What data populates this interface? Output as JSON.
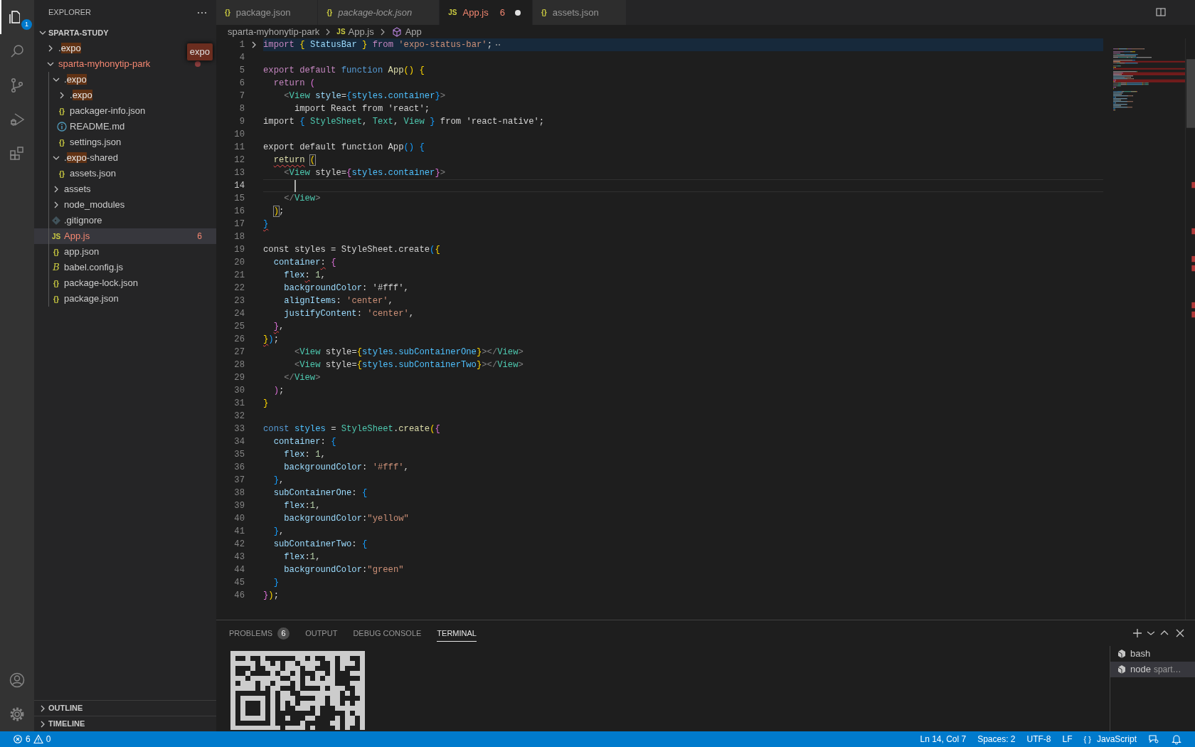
{
  "activity_bar": {
    "items": [
      {
        "kind": "explorer",
        "selected": true,
        "badge": "1"
      },
      {
        "kind": "search",
        "selected": false
      },
      {
        "kind": "source-control",
        "selected": false
      },
      {
        "kind": "run-debug",
        "selected": false
      },
      {
        "kind": "extensions",
        "selected": false
      }
    ],
    "bottom_items": [
      {
        "kind": "account"
      },
      {
        "kind": "settings"
      }
    ]
  },
  "sidebar": {
    "title": "EXPLORER",
    "filter": {
      "value": "expo"
    },
    "workspace": {
      "label": "SPARTA-STUDY",
      "expanded": true,
      "tree": [
        {
          "label_parts": [
            {
              "text": ".",
              "match": false
            },
            {
              "text": "expo",
              "match": true
            }
          ],
          "kind": "folder",
          "expanded": false,
          "selected": false,
          "problem": false
        },
        {
          "label_parts": [
            {
              "text": "sparta-myhonytip-park",
              "match": false
            }
          ],
          "kind": "folder",
          "expanded": true,
          "selected": false,
          "problem": true,
          "children": [
            {
              "label_parts": [
                {
                  "text": ".",
                  "match": false
                },
                {
                  "text": "expo",
                  "match": true
                }
              ],
              "kind": "folder",
              "expanded": true,
              "selected": false,
              "problem": false,
              "children": [
                {
                  "label_parts": [
                    {
                      "text": ".",
                      "match": false
                    },
                    {
                      "text": "expo",
                      "match": true
                    }
                  ],
                  "kind": "folder",
                  "expanded": false,
                  "selected": false,
                  "problem": false
                },
                {
                  "label_parts": [
                    {
                      "text": "packager-info.json",
                      "match": false
                    }
                  ],
                  "kind": "file",
                  "glyph": "{}",
                  "selected": false,
                  "problem": false
                },
                {
                  "label_parts": [
                    {
                      "text": "README.md",
                      "match": false
                    }
                  ],
                  "kind": "readme",
                  "selected": false,
                  "problem": false
                },
                {
                  "label_parts": [
                    {
                      "text": "settings.json",
                      "match": false
                    }
                  ],
                  "kind": "file",
                  "glyph": "{}",
                  "selected": false,
                  "problem": false
                }
              ]
            },
            {
              "label_parts": [
                {
                  "text": ".",
                  "match": false
                },
                {
                  "text": "expo",
                  "match": true
                },
                {
                  "text": "-shared",
                  "match": false
                }
              ],
              "kind": "folder",
              "expanded": true,
              "selected": false,
              "problem": false,
              "children": [
                {
                  "label_parts": [
                    {
                      "text": "assets.json",
                      "match": false
                    }
                  ],
                  "kind": "file",
                  "glyph": "{}",
                  "selected": false,
                  "problem": false
                }
              ]
            },
            {
              "label_parts": [
                {
                  "text": "assets",
                  "match": false
                }
              ],
              "kind": "folder",
              "expanded": false,
              "selected": false,
              "problem": false
            },
            {
              "label_parts": [
                {
                  "text": "node_modules",
                  "match": false
                }
              ],
              "kind": "folder",
              "expanded": false,
              "selected": false,
              "problem": false
            },
            {
              "label_parts": [
                {
                  "text": ".gitignore",
                  "match": false
                }
              ],
              "kind": "gitignore",
              "selected": false,
              "problem": false
            },
            {
              "label_parts": [
                {
                  "text": "App.js",
                  "match": false
                }
              ],
              "kind": "file",
              "glyph": "JS",
              "selected": true,
              "problem": true,
              "badge": "6"
            },
            {
              "label_parts": [
                {
                  "text": "app.json",
                  "match": false
                }
              ],
              "kind": "file",
              "glyph": "{}",
              "selected": false,
              "problem": false
            },
            {
              "label_parts": [
                {
                  "text": "babel.config.js",
                  "match": false
                }
              ],
              "kind": "file",
              "glyph": "B",
              "selected": false,
              "problem": false
            },
            {
              "label_parts": [
                {
                  "text": "package-lock.json",
                  "match": false
                }
              ],
              "kind": "file",
              "glyph": "{}",
              "selected": false,
              "problem": false
            },
            {
              "label_parts": [
                {
                  "text": "package.json",
                  "match": false
                }
              ],
              "kind": "file",
              "glyph": "{}",
              "selected": false,
              "problem": false
            }
          ]
        }
      ]
    },
    "sections": [
      {
        "label": "OUTLINE",
        "expanded": false
      },
      {
        "label": "TIMELINE",
        "expanded": false
      }
    ]
  },
  "tabs": [
    {
      "label": "package.json",
      "glyph": "{}",
      "selected": false,
      "preview": false,
      "modified": false,
      "problem": false
    },
    {
      "label": "package-lock.json",
      "glyph": "{}",
      "selected": false,
      "preview": true,
      "modified": false,
      "problem": false
    },
    {
      "label": "App.js",
      "glyph": "JS",
      "selected": true,
      "preview": false,
      "modified": true,
      "problem": true,
      "badge": "6"
    },
    {
      "label": "assets.json",
      "glyph": "{}",
      "selected": false,
      "preview": false,
      "modified": false,
      "problem": false
    }
  ],
  "breadcrumbs": [
    {
      "label": "sparta-myhonytip-park",
      "kind": "folder"
    },
    {
      "label": "App.js",
      "kind": "file",
      "glyph": "JS"
    },
    {
      "label": "App",
      "kind": "symbol"
    }
  ],
  "editor": {
    "lines": [
      {
        "number": "1",
        "folded": true,
        "current": false,
        "tokens": [
          {
            "text": "import ",
            "kind": "keyword"
          },
          {
            "text": "{",
            "kind": "bracket1"
          },
          {
            "text": " StatusBar ",
            "kind": "variable"
          },
          {
            "text": "}",
            "kind": "bracket1"
          },
          {
            "text": " from ",
            "kind": "keyword"
          },
          {
            "text": "'expo-status-bar'",
            "kind": "string"
          },
          {
            "text": ";",
            "kind": "plain"
          }
        ]
      },
      {
        "number": "4",
        "folded": false,
        "current": false
      },
      {
        "number": "5",
        "folded": false,
        "current": false,
        "tokens": [
          {
            "text": "export default ",
            "kind": "keyword"
          },
          {
            "text": "function ",
            "kind": "storage"
          },
          {
            "text": "App",
            "kind": "function"
          },
          {
            "text": "()",
            "kind": "bracket1"
          },
          {
            "text": " {",
            "kind": "bracket1"
          }
        ]
      },
      {
        "number": "6",
        "folded": false,
        "current": false,
        "tokens": [
          {
            "text": "  return ",
            "kind": "keyword"
          },
          {
            "text": "(",
            "kind": "bracket2"
          }
        ]
      },
      {
        "number": "7",
        "folded": false,
        "current": false,
        "tokens": [
          {
            "text": "    <",
            "kind": "tag"
          },
          {
            "text": "View ",
            "kind": "type"
          },
          {
            "text": "style",
            "kind": "variable"
          },
          {
            "text": "=",
            "kind": "plain"
          },
          {
            "text": "{",
            "kind": "bracket3"
          },
          {
            "text": "styles.container",
            "kind": "constant"
          },
          {
            "text": "}",
            "kind": "bracket3"
          },
          {
            "text": ">",
            "kind": "tag"
          }
        ]
      },
      {
        "number": "8",
        "folded": false,
        "current": false,
        "tokens": [
          {
            "text": "      import React from 'react';",
            "kind": "plain"
          }
        ]
      },
      {
        "number": "9",
        "folded": false,
        "current": false,
        "tokens": [
          {
            "text": "import ",
            "kind": "plain"
          },
          {
            "text": "{",
            "kind": "bracket3"
          },
          {
            "text": " StyleSheet",
            "kind": "type"
          },
          {
            "text": ", ",
            "kind": "plain"
          },
          {
            "text": "Text",
            "kind": "type"
          },
          {
            "text": ", ",
            "kind": "plain"
          },
          {
            "text": "View",
            "kind": "type"
          },
          {
            "text": " }",
            "kind": "bracket3"
          },
          {
            "text": " from 'react-native';",
            "kind": "plain"
          }
        ]
      },
      {
        "number": "10",
        "folded": false,
        "current": false
      },
      {
        "number": "11",
        "folded": false,
        "current": false,
        "tokens": [
          {
            "text": "export default function App",
            "kind": "plain"
          },
          {
            "text": "()",
            "kind": "bracket3"
          },
          {
            "text": " {",
            "kind": "bracket3"
          }
        ]
      },
      {
        "number": "12",
        "folded": false,
        "current": false,
        "tokens": [
          {
            "text": "  return ",
            "kind": "function",
            "error": true
          },
          {
            "text": "(",
            "kind": "bracket1",
            "matched": true
          }
        ]
      },
      {
        "number": "13",
        "folded": false,
        "current": false,
        "tokens": [
          {
            "text": "    <",
            "kind": "tag"
          },
          {
            "text": "View",
            "kind": "type"
          },
          {
            "text": " style=",
            "kind": "plain"
          },
          {
            "text": "{",
            "kind": "bracket2"
          },
          {
            "text": "styles.container",
            "kind": "constant"
          },
          {
            "text": "}",
            "kind": "bracket2"
          },
          {
            "text": ">",
            "kind": "tag"
          }
        ]
      },
      {
        "number": "14",
        "folded": false,
        "current": true
      },
      {
        "number": "15",
        "folded": false,
        "current": false,
        "tokens": [
          {
            "text": "    </",
            "kind": "tag"
          },
          {
            "text": "View",
            "kind": "type"
          },
          {
            "text": ">",
            "kind": "tag"
          }
        ]
      },
      {
        "number": "16",
        "folded": false,
        "current": false,
        "tokens": [
          {
            "text": "  )",
            "kind": "bracket1",
            "matched": true
          },
          {
            "text": ";",
            "kind": "plain"
          }
        ]
      },
      {
        "number": "17",
        "folded": false,
        "current": false,
        "tokens": [
          {
            "text": "}",
            "kind": "bracket3",
            "error": true
          }
        ]
      },
      {
        "number": "18",
        "folded": false,
        "current": false
      },
      {
        "number": "19",
        "folded": false,
        "current": false,
        "tokens": [
          {
            "text": "const styles = StyleSheet.create",
            "kind": "plain"
          },
          {
            "text": "(",
            "kind": "bracket3"
          },
          {
            "text": "{",
            "kind": "bracket1"
          }
        ]
      },
      {
        "number": "20",
        "folded": false,
        "current": false,
        "tokens": [
          {
            "text": "  container",
            "kind": "variable"
          },
          {
            "text": ":",
            "kind": "plain",
            "error": true
          },
          {
            "text": " {",
            "kind": "bracket2"
          }
        ]
      },
      {
        "number": "21",
        "folded": false,
        "current": false,
        "tokens": [
          {
            "text": "    flex",
            "kind": "variable"
          },
          {
            "text": ":",
            "kind": "plain",
            "error": true
          },
          {
            "text": " 1",
            "kind": "number"
          },
          {
            "text": ",",
            "kind": "plain"
          }
        ]
      },
      {
        "number": "22",
        "folded": false,
        "current": false,
        "tokens": [
          {
            "text": "    backgroundColor",
            "kind": "variable"
          },
          {
            "text": ": '#fff',",
            "kind": "plain"
          }
        ]
      },
      {
        "number": "23",
        "folded": false,
        "current": false,
        "tokens": [
          {
            "text": "    alignItems",
            "kind": "variable"
          },
          {
            "text": ": ",
            "kind": "plain"
          },
          {
            "text": "'center'",
            "kind": "string"
          },
          {
            "text": ",",
            "kind": "plain"
          }
        ]
      },
      {
        "number": "24",
        "folded": false,
        "current": false,
        "tokens": [
          {
            "text": "    justifyContent",
            "kind": "variable"
          },
          {
            "text": ": ",
            "kind": "plain"
          },
          {
            "text": "'center'",
            "kind": "string"
          },
          {
            "text": ",",
            "kind": "plain"
          }
        ]
      },
      {
        "number": "25",
        "folded": false,
        "current": false,
        "tokens": [
          {
            "text": "  }",
            "kind": "bracket2",
            "error": true
          },
          {
            "text": ",",
            "kind": "plain"
          }
        ]
      },
      {
        "number": "26",
        "folded": false,
        "current": false,
        "tokens": [
          {
            "text": "}",
            "kind": "bracket1",
            "error": true
          },
          {
            "text": ")",
            "kind": "bracket3"
          },
          {
            "text": ";",
            "kind": "plain"
          }
        ]
      },
      {
        "number": "27",
        "folded": false,
        "current": false,
        "tokens": [
          {
            "text": "      <",
            "kind": "tag"
          },
          {
            "text": "View",
            "kind": "type"
          },
          {
            "text": " style=",
            "kind": "plain"
          },
          {
            "text": "{",
            "kind": "bracket1"
          },
          {
            "text": "styles.subContainerOne",
            "kind": "constant"
          },
          {
            "text": "}",
            "kind": "bracket1"
          },
          {
            "text": "></",
            "kind": "tag"
          },
          {
            "text": "View",
            "kind": "type"
          },
          {
            "text": ">",
            "kind": "tag"
          }
        ]
      },
      {
        "number": "28",
        "folded": false,
        "current": false,
        "tokens": [
          {
            "text": "      <",
            "kind": "tag"
          },
          {
            "text": "View",
            "kind": "type"
          },
          {
            "text": " style=",
            "kind": "plain"
          },
          {
            "text": "{",
            "kind": "bracket1"
          },
          {
            "text": "styles.subContainerTwo",
            "kind": "constant"
          },
          {
            "text": "}",
            "kind": "bracket1"
          },
          {
            "text": "></",
            "kind": "tag"
          },
          {
            "text": "View",
            "kind": "type"
          },
          {
            "text": ">",
            "kind": "tag"
          }
        ]
      },
      {
        "number": "29",
        "folded": false,
        "current": false,
        "tokens": [
          {
            "text": "    </",
            "kind": "tag"
          },
          {
            "text": "View",
            "kind": "type"
          },
          {
            "text": ">",
            "kind": "tag"
          }
        ]
      },
      {
        "number": "30",
        "folded": false,
        "current": false,
        "tokens": [
          {
            "text": "  )",
            "kind": "bracket2"
          },
          {
            "text": ";",
            "kind": "plain"
          }
        ]
      },
      {
        "number": "31",
        "folded": false,
        "current": false,
        "tokens": [
          {
            "text": "}",
            "kind": "bracket1"
          }
        ]
      },
      {
        "number": "32",
        "folded": false,
        "current": false
      },
      {
        "number": "33",
        "folded": false,
        "current": false,
        "tokens": [
          {
            "text": "const ",
            "kind": "storage"
          },
          {
            "text": "styles",
            "kind": "constant"
          },
          {
            "text": " = ",
            "kind": "plain"
          },
          {
            "text": "StyleSheet",
            "kind": "type"
          },
          {
            "text": ".",
            "kind": "plain"
          },
          {
            "text": "create",
            "kind": "function"
          },
          {
            "text": "(",
            "kind": "bracket1"
          },
          {
            "text": "{",
            "kind": "bracket2"
          }
        ]
      },
      {
        "number": "34",
        "folded": false,
        "current": false,
        "tokens": [
          {
            "text": "  container",
            "kind": "variable"
          },
          {
            "text": ": ",
            "kind": "plain"
          },
          {
            "text": "{",
            "kind": "bracket3"
          }
        ]
      },
      {
        "number": "35",
        "folded": false,
        "current": false,
        "tokens": [
          {
            "text": "    flex",
            "kind": "variable"
          },
          {
            "text": ": ",
            "kind": "plain"
          },
          {
            "text": "1",
            "kind": "number"
          },
          {
            "text": ",",
            "kind": "plain"
          }
        ]
      },
      {
        "number": "36",
        "folded": false,
        "current": false,
        "tokens": [
          {
            "text": "    backgroundColor",
            "kind": "variable"
          },
          {
            "text": ": ",
            "kind": "plain"
          },
          {
            "text": "'#fff'",
            "kind": "string"
          },
          {
            "text": ",",
            "kind": "plain"
          }
        ]
      },
      {
        "number": "37",
        "folded": false,
        "current": false,
        "tokens": [
          {
            "text": "  }",
            "kind": "bracket3"
          },
          {
            "text": ",",
            "kind": "plain"
          }
        ]
      },
      {
        "number": "38",
        "folded": false,
        "current": false,
        "tokens": [
          {
            "text": "  subContainerOne",
            "kind": "variable"
          },
          {
            "text": ": ",
            "kind": "plain"
          },
          {
            "text": "{",
            "kind": "bracket3"
          }
        ]
      },
      {
        "number": "39",
        "folded": false,
        "current": false,
        "tokens": [
          {
            "text": "    flex",
            "kind": "variable"
          },
          {
            "text": ":",
            "kind": "plain"
          },
          {
            "text": "1",
            "kind": "number"
          },
          {
            "text": ",",
            "kind": "plain"
          }
        ]
      },
      {
        "number": "40",
        "folded": false,
        "current": false,
        "tokens": [
          {
            "text": "    backgroundColor",
            "kind": "variable"
          },
          {
            "text": ":",
            "kind": "plain"
          },
          {
            "text": "\"yellow\"",
            "kind": "string"
          }
        ]
      },
      {
        "number": "41",
        "folded": false,
        "current": false,
        "tokens": [
          {
            "text": "  }",
            "kind": "bracket3"
          },
          {
            "text": ",",
            "kind": "plain"
          }
        ]
      },
      {
        "number": "42",
        "folded": false,
        "current": false,
        "tokens": [
          {
            "text": "  subContainerTwo",
            "kind": "variable"
          },
          {
            "text": ": ",
            "kind": "plain"
          },
          {
            "text": "{",
            "kind": "bracket3"
          }
        ]
      },
      {
        "number": "43",
        "folded": false,
        "current": false,
        "tokens": [
          {
            "text": "    flex",
            "kind": "variable"
          },
          {
            "text": ":",
            "kind": "plain"
          },
          {
            "text": "1",
            "kind": "number"
          },
          {
            "text": ",",
            "kind": "plain"
          }
        ]
      },
      {
        "number": "44",
        "folded": false,
        "current": false,
        "tokens": [
          {
            "text": "    backgroundColor",
            "kind": "variable"
          },
          {
            "text": ":",
            "kind": "plain"
          },
          {
            "text": "\"green\"",
            "kind": "string"
          }
        ]
      },
      {
        "number": "45",
        "folded": false,
        "current": false,
        "tokens": [
          {
            "text": "  }",
            "kind": "bracket3"
          }
        ]
      },
      {
        "number": "46",
        "folded": false,
        "current": false,
        "tokens": [
          {
            "text": "}",
            "kind": "bracket2"
          },
          {
            "text": ")",
            "kind": "bracket1"
          },
          {
            "text": ";",
            "kind": "plain"
          }
        ]
      }
    ]
  },
  "panel": {
    "tabs": [
      {
        "label": "PROBLEMS",
        "badge": "6",
        "selected": false
      },
      {
        "label": "OUTPUT",
        "selected": false
      },
      {
        "label": "DEBUG CONSOLE",
        "selected": false
      },
      {
        "label": "TERMINAL",
        "selected": true
      }
    ],
    "terminal": {
      "output": {
        "kind": "qr-code"
      },
      "sessions": [
        {
          "label": "bash",
          "selected": false
        },
        {
          "label": "node",
          "detail": "spart…",
          "selected": true
        }
      ]
    }
  },
  "status_bar": {
    "errors": "6",
    "warnings": "0",
    "items": [
      {
        "label": "Ln 14, Col 7"
      },
      {
        "label": "Spaces: 2"
      },
      {
        "label": "UTF-8"
      },
      {
        "label": "LF"
      },
      {
        "label": "JavaScript",
        "glyph": "{ }"
      }
    ]
  }
}
